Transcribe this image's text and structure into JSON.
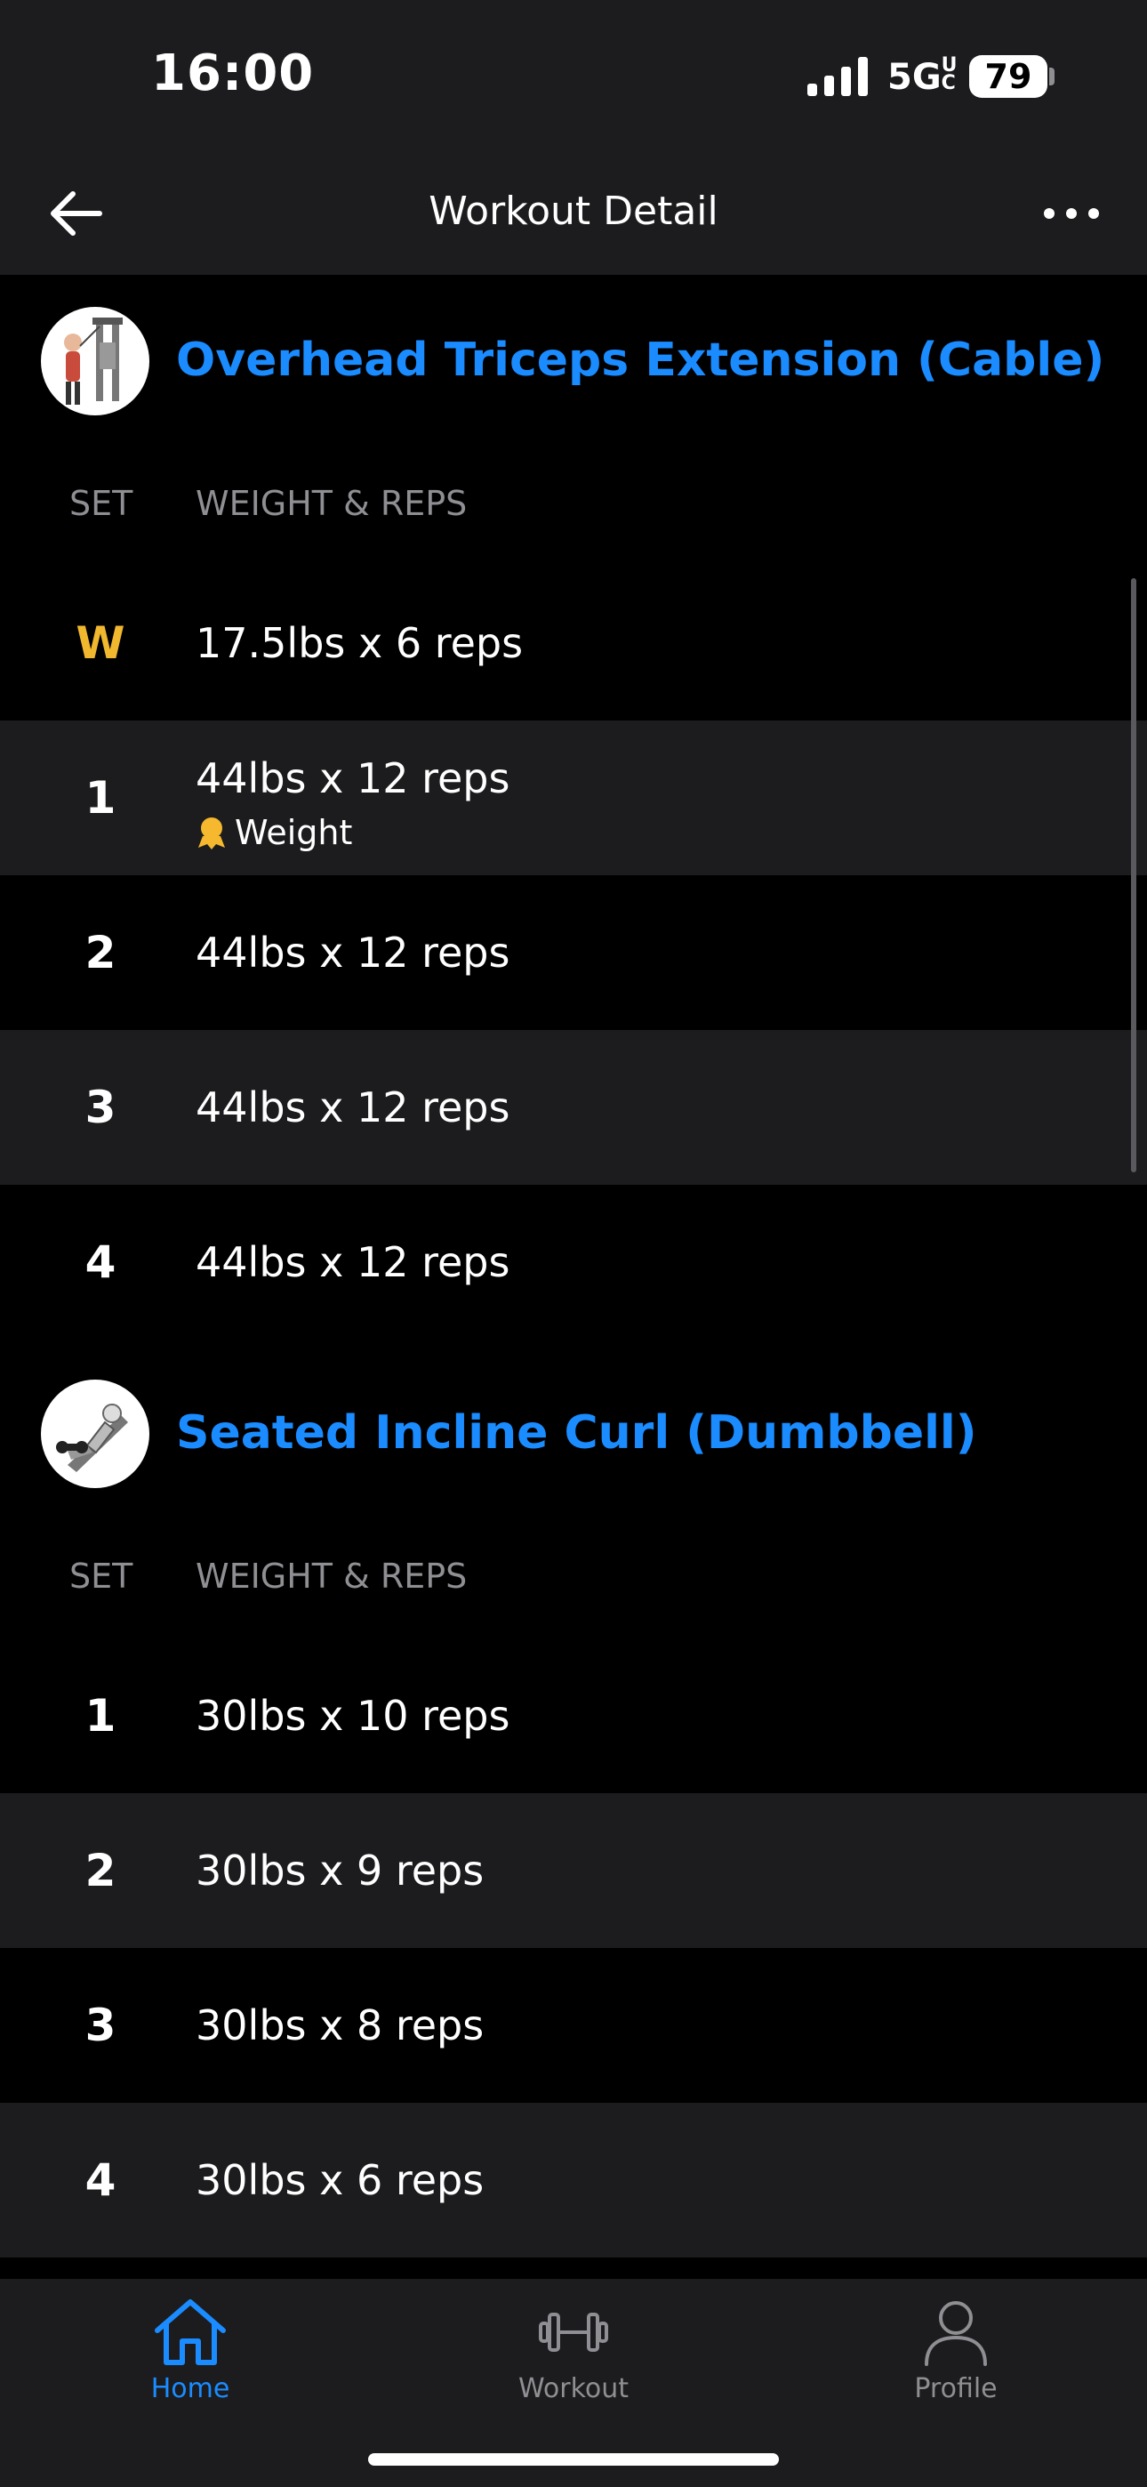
{
  "status_bar": {
    "time": "16:00",
    "network": "5G",
    "network_sub": "UC",
    "battery": "79"
  },
  "header": {
    "title": "Workout Detail"
  },
  "exercises": [
    {
      "name": "Overhead Triceps Extension (Cable)",
      "col_set": "SET",
      "col_weight_reps": "WEIGHT & REPS",
      "sets": [
        {
          "set": "W",
          "text": "17.5lbs x 6 reps"
        },
        {
          "set": "1",
          "text": "44lbs x 12 reps",
          "badge": "Weight"
        },
        {
          "set": "2",
          "text": "44lbs x 12 reps"
        },
        {
          "set": "3",
          "text": "44lbs x 12 reps"
        },
        {
          "set": "4",
          "text": "44lbs x 12 reps"
        }
      ]
    },
    {
      "name": "Seated Incline Curl (Dumbbell)",
      "col_set": "SET",
      "col_weight_reps": "WEIGHT & REPS",
      "sets": [
        {
          "set": "1",
          "text": "30lbs x 10 reps"
        },
        {
          "set": "2",
          "text": "30lbs x 9 reps"
        },
        {
          "set": "3",
          "text": "30lbs x 8 reps"
        },
        {
          "set": "4",
          "text": "30lbs x 6 reps"
        }
      ]
    }
  ],
  "tabs": [
    {
      "label": "Home",
      "icon": "home-icon",
      "active": true
    },
    {
      "label": "Workout",
      "icon": "dumbbell-icon",
      "active": false
    },
    {
      "label": "Profile",
      "icon": "profile-icon",
      "active": false
    }
  ],
  "colors": {
    "accent": "#1a8cff",
    "warmup": "#f0b72f",
    "row_alt": "#1c1c1e",
    "medal": "#f5b82e"
  }
}
